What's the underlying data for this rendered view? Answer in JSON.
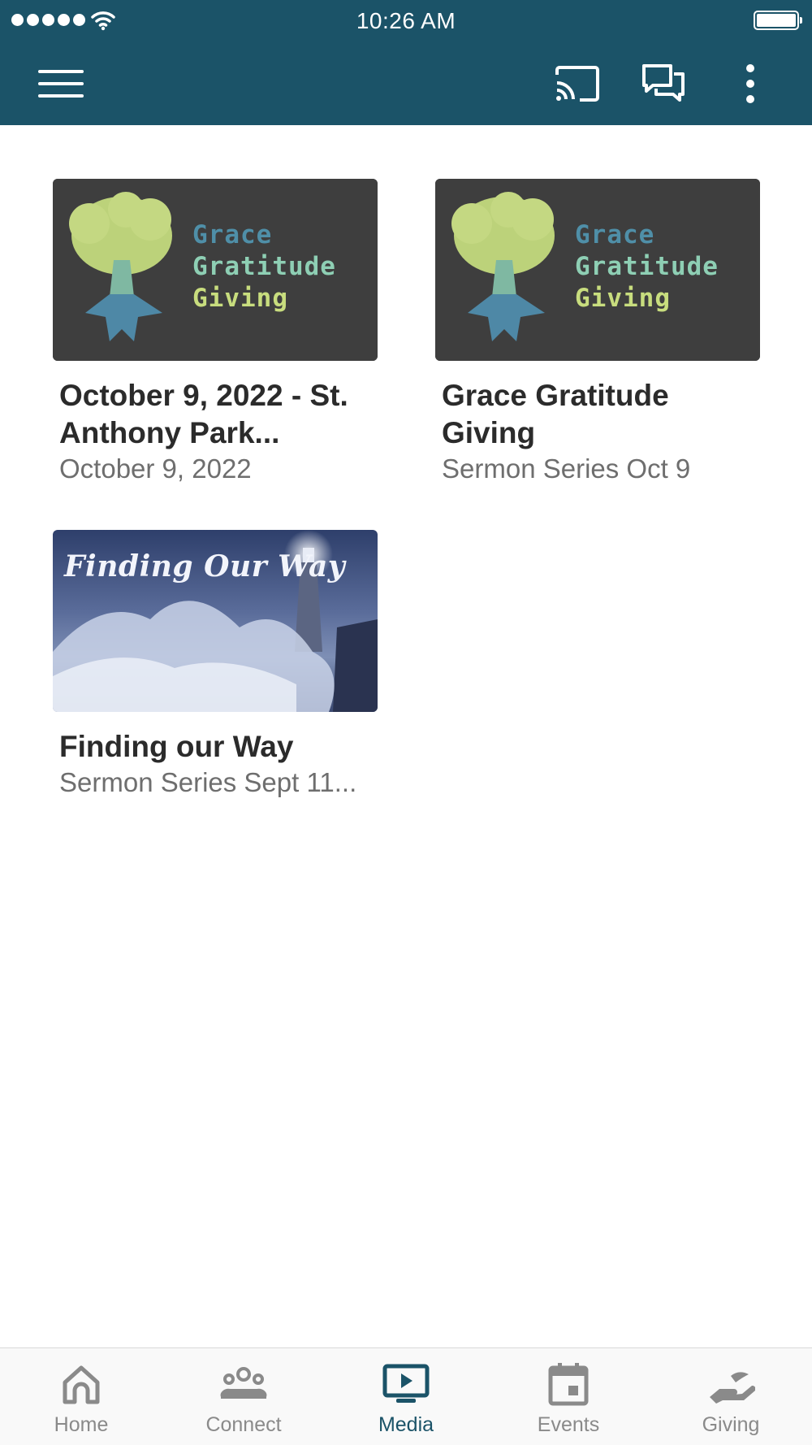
{
  "status_bar": {
    "time": "10:26 AM"
  },
  "app_bar": {
    "menu_icon": "hamburger-menu-icon",
    "actions": [
      "cast-icon",
      "chat-icon",
      "more-vertical-icon"
    ],
    "color": "#1b5368"
  },
  "media_items": [
    {
      "title": "October 9, 2022 - St. Anthony Park...",
      "subtitle": "October 9, 2022",
      "thumbnail_text": [
        "Grace",
        "Gratitude",
        "Giving"
      ]
    },
    {
      "title": "Grace Gratitude Giving",
      "subtitle": "Sermon Series Oct 9",
      "thumbnail_text": [
        "Grace",
        "Gratitude",
        "Giving"
      ]
    },
    {
      "title": "Finding our Way",
      "subtitle": "Sermon Series Sept 11...",
      "thumbnail_text": [
        "Finding Our Way"
      ]
    }
  ],
  "tabs": [
    {
      "label": "Home",
      "icon": "home-icon",
      "active": false
    },
    {
      "label": "Connect",
      "icon": "people-icon",
      "active": false
    },
    {
      "label": "Media",
      "icon": "tv-play-icon",
      "active": true
    },
    {
      "label": "Events",
      "icon": "calendar-icon",
      "active": false
    },
    {
      "label": "Giving",
      "icon": "giving-hand-icon",
      "active": false
    }
  ],
  "colors": {
    "primary": "#1b5368",
    "tab_inactive": "#8a8a8a"
  }
}
